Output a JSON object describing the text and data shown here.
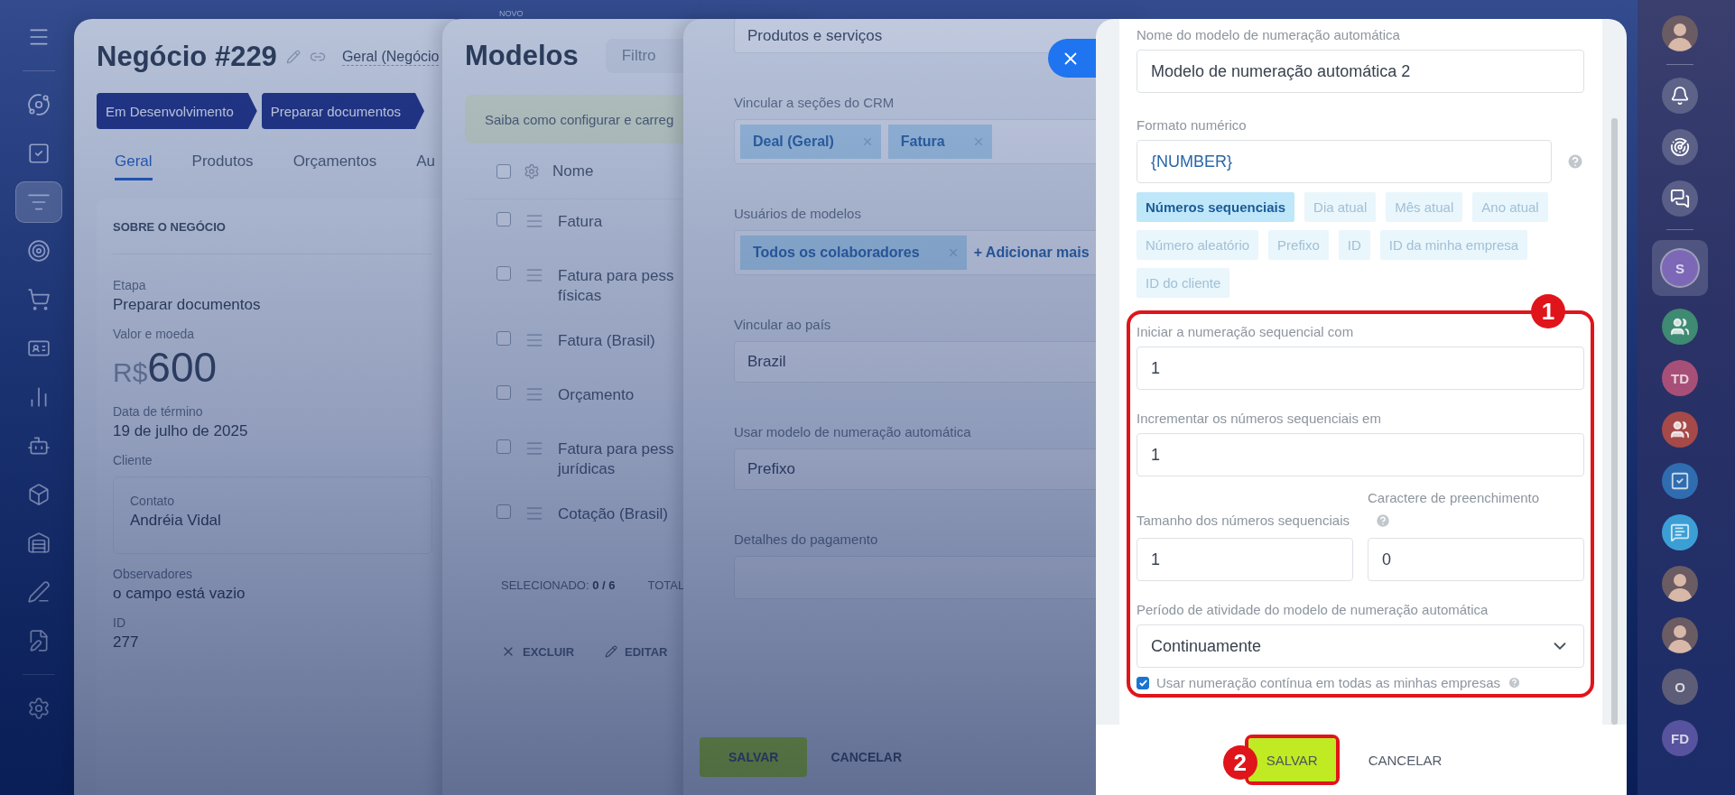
{
  "novo_label": "NOVO",
  "left_rail": {
    "items": [
      {
        "kind": "menu",
        "selected": false
      },
      {
        "kind": "process",
        "selected": false
      },
      {
        "kind": "tasks",
        "selected": false
      },
      {
        "kind": "funnel",
        "selected": true
      },
      {
        "kind": "target",
        "selected": false
      },
      {
        "kind": "cart",
        "selected": false
      },
      {
        "kind": "contacts",
        "selected": false
      },
      {
        "kind": "chart",
        "selected": false
      },
      {
        "kind": "robot",
        "selected": false
      },
      {
        "kind": "box",
        "selected": false
      },
      {
        "kind": "store",
        "selected": false
      },
      {
        "kind": "sign",
        "selected": false
      },
      {
        "kind": "document",
        "selected": false
      },
      {
        "kind": "settings",
        "selected": false
      }
    ]
  },
  "deal_panel": {
    "title": "Negócio #229",
    "category": "Geral (Negócio",
    "stages": [
      "Em Desenvolvimento",
      "Preparar documentos"
    ],
    "tabs": [
      {
        "label": "Geral",
        "selected": true
      },
      {
        "label": "Produtos",
        "selected": false
      },
      {
        "label": "Orçamentos",
        "selected": false
      },
      {
        "label": "Au",
        "selected": false
      }
    ],
    "section_title": "SOBRE O NEGÓCIO",
    "fields": [
      {
        "kind": "text",
        "label": "Etapa",
        "value": "Preparar documentos"
      },
      {
        "kind": "money",
        "label": "Valor e moeda",
        "currency": "R$",
        "value": "600"
      },
      {
        "kind": "text",
        "label": "Data de término",
        "value": "19 de julho de 2025"
      },
      {
        "kind": "contact",
        "label": "Cliente",
        "contact_label": "Contato",
        "value": "Andréia Vidal"
      },
      {
        "kind": "text",
        "label": "Observadores",
        "value": "o campo está vazio"
      },
      {
        "kind": "text",
        "label": "ID",
        "value": "277"
      }
    ]
  },
  "models_panel": {
    "title": "Modelos",
    "filter_placeholder": "Filtro",
    "hint": "Saiba como configurar e carreg",
    "column": "Nome",
    "select_all_checked": false,
    "rows": [
      {
        "lines": [
          "Fatura"
        ],
        "checked": false
      },
      {
        "lines": [
          "Fatura para pess",
          "físicas"
        ],
        "checked": false
      },
      {
        "lines": [
          "Fatura (Brasil)"
        ],
        "checked": false
      },
      {
        "lines": [
          "Orçamento"
        ],
        "checked": false
      },
      {
        "lines": [
          "Fatura para pess",
          "jurídicas"
        ],
        "checked": false
      },
      {
        "lines": [
          "Cotação (Brasil)"
        ],
        "checked": false
      }
    ],
    "selected_count": "SELECIONADO: **0 / 6**",
    "total": "TOTAL",
    "actions": [
      "EXCLUIR",
      "EDITAR"
    ]
  },
  "template_panel": {
    "top_value": "Produtos e serviços",
    "fields": [
      {
        "kind": "tags",
        "label": "Vincular a seções do CRM",
        "tags": [
          "Deal (Geral)",
          "Fatura"
        ]
      },
      {
        "kind": "tags",
        "label": "Usuários de modelos",
        "tags": [
          "Todos os colaboradores"
        ],
        "add_link": "+ Adicionar mais"
      },
      {
        "kind": "select",
        "label": "Vincular ao país",
        "value": "Brazil"
      },
      {
        "kind": "select",
        "label": "Usar modelo de numeração automática",
        "value": "Prefixo"
      },
      {
        "kind": "textarea",
        "label": "Detalhes do pagamento"
      }
    ],
    "buttons": [
      "SALVAR",
      "CANCELAR"
    ]
  },
  "numbering_panel": {
    "name_label": "Nome do modelo de numeração automática",
    "name_value": "Modelo de numeração automática 2",
    "format_label": "Formato numérico",
    "format_value": "{NUMBER}",
    "chips": [
      {
        "label": "Números sequenciais",
        "selected": true
      },
      {
        "label": "Dia atual",
        "selected": false
      },
      {
        "label": "Mês atual",
        "selected": false
      },
      {
        "label": "Ano atual",
        "selected": false
      },
      {
        "label": "Número aleatório",
        "selected": false
      },
      {
        "label": "Prefixo",
        "selected": false
      },
      {
        "label": "ID",
        "selected": false
      },
      {
        "label": "ID da minha empresa",
        "selected": false
      },
      {
        "label": "ID do cliente",
        "selected": false
      }
    ],
    "start_label": "Iniciar a numeração sequencial com",
    "start_value": "1",
    "step_label": "Incrementar os números sequenciais em",
    "step_value": "1",
    "size_label": "Tamanho dos números sequenciais",
    "size_value": "1",
    "pad_label": "Caractere de preenchimento",
    "pad_value": "0",
    "period_label": "Período de atividade do modelo de numeração automática",
    "period_value": "Continuamente",
    "checkbox": {
      "label": "Usar numeração contínua em todas as minhas empresas",
      "checked": true
    },
    "buttons": [
      "SALVAR",
      "CANCELAR"
    ],
    "callouts": [
      {
        "number": "1"
      },
      {
        "number": "2"
      }
    ]
  },
  "right_sidebar": {
    "items": [
      {
        "kind": "photo",
        "selected": false
      },
      {
        "kind": "bell",
        "selected": false
      },
      {
        "kind": "sparkle",
        "selected": false
      },
      {
        "kind": "chat-swap",
        "selected": false
      },
      {
        "kind": "letter",
        "initials": "S",
        "color": "#7d68b8",
        "selected": true
      },
      {
        "kind": "group",
        "color": "#3f8a72",
        "selected": false
      },
      {
        "kind": "letter",
        "initials": "TD",
        "color": "#a84f78",
        "selected": false
      },
      {
        "kind": "group",
        "color": "#a54a48",
        "selected": false
      },
      {
        "kind": "task",
        "color": "#2f6db0",
        "selected": false
      },
      {
        "kind": "chat",
        "color": "#3b9fd6",
        "selected": false
      },
      {
        "kind": "photo",
        "selected": false
      },
      {
        "kind": "photo",
        "selected": false
      },
      {
        "kind": "letter",
        "initials": "O",
        "color": "#5e5d78",
        "selected": false
      },
      {
        "kind": "letter",
        "initials": "FD",
        "color": "#57539e",
        "selected": false
      }
    ]
  }
}
